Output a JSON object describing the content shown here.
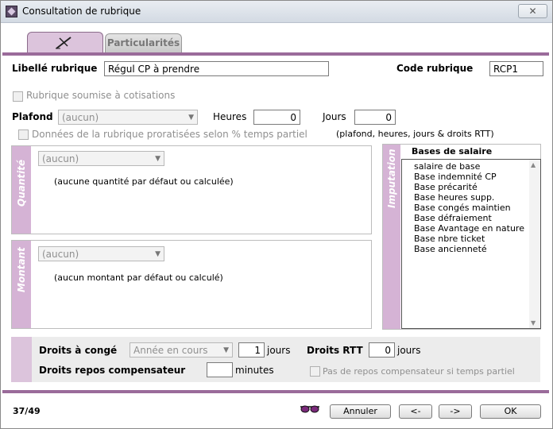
{
  "window": {
    "title": "Consultation de rubrique",
    "close_label": "✕"
  },
  "tabs": [
    {
      "label": "",
      "icon": "pen-icon",
      "active": true
    },
    {
      "label": "Particularités",
      "active": false
    }
  ],
  "form": {
    "libelle_label": "Libellé rubrique",
    "libelle_value": "Régul CP à prendre",
    "code_label": "Code rubrique",
    "code_value": "RCP1",
    "cotisations_label": "Rubrique soumise à cotisations",
    "plafond_label": "Plafond",
    "plafond_value": "(aucun)",
    "heures_label": "Heures",
    "heures_value": "0",
    "jours_label": "Jours",
    "jours_value": "0",
    "prorata_label": "Données de la rubrique proratisées selon % temps partiel",
    "prorata_note": "(plafond, heures, jours & droits RTT)"
  },
  "quantite": {
    "title": "Quantité",
    "combo_value": "(aucun)",
    "note": "(aucune quantité par défaut ou calculée)"
  },
  "montant": {
    "title": "Montant",
    "combo_value": "(aucun)",
    "note": "(aucun montant par défaut ou calculé)"
  },
  "imputation": {
    "title": "Imputation",
    "header": "Bases de salaire",
    "items": [
      "salaire de base",
      "Base indemnité CP",
      "Base précarité",
      "Base heures supp.",
      "Base congés maintien",
      "Base défraiement",
      "Base Avantage en nature",
      "Base nbre ticket",
      "Base ancienneté"
    ]
  },
  "droits": {
    "conge_label": "Droits à congé",
    "conge_combo": "Année en cours",
    "conge_value": "1",
    "conge_unit": "jours",
    "rtt_label": "Droits RTT",
    "rtt_value": "0",
    "rtt_unit": "jours",
    "repos_label": "Droits repos compensateur",
    "repos_value": "",
    "repos_unit": "minutes",
    "pas_repos_label": "Pas de repos compensateur si temps partiel"
  },
  "footer": {
    "counter": "37/49",
    "annuler": "Annuler",
    "prev": "<-",
    "next": "->",
    "ok": "OK"
  },
  "colors": {
    "accent": "#9a6b9a",
    "sidebar": "#d5b3d5"
  }
}
